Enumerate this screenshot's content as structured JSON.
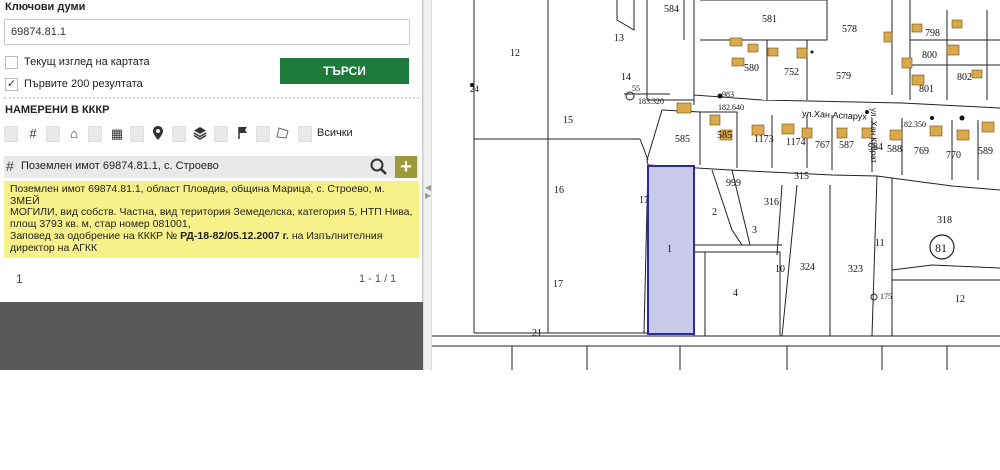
{
  "sidebar": {
    "keywords_label": "Ключови думи",
    "search_value": "69874.81.1",
    "option_current_view": "Текущ изглед на картата",
    "option_first_200": "Първите 200 резултата",
    "option_first_200_checked": true,
    "search_button": "ТЪРСИ",
    "found_in_label": "НАМЕРЕНИ В КККР",
    "filter_all_label": "Всички",
    "filter_icons": [
      "hash-icon",
      "home-icon",
      "building-icon",
      "location-pin-icon",
      "layers-icon",
      "flag-icon",
      "polygon-icon"
    ]
  },
  "result": {
    "title": "Поземлен имот 69874.81.1, с. Строево",
    "desc_line1": "Поземлен имот 69874.81.1, област Пловдив, община Марица, с. Строево, м. ЗМЕЙ",
    "desc_line2": "МОГИЛИ, вид собств. Частна, вид територия Земеделска, категория 5, НТП Нива,",
    "desc_line3": "площ 3793 кв. м, стар номер 081001,",
    "order_prefix": "Заповед за одобрение на КККР №",
    "order_number": "РД-18-82/05.12.2007 г.",
    "order_suffix": " на Изпълнителния",
    "order_line2": "директор на АГКК"
  },
  "pager": {
    "page": "1",
    "range": "1 - 1 / 1"
  },
  "map": {
    "street_1": "ул.Хан Аспарух",
    "street_2": "ул. Хан Кубрат",
    "elev_1": "183.320",
    "elev_2": "182.640",
    "elev_3": "182.350",
    "elev_4": "175",
    "circle_label": "81",
    "highlight_color": "#c9c9ea",
    "highlight_stroke": "#2a2aa8",
    "parcels": [
      "584",
      "581",
      "578",
      "798",
      "13",
      "12",
      "580",
      "752",
      "579",
      "800",
      "802",
      "14",
      "55",
      "983",
      "801",
      "24",
      "15",
      "585",
      "585",
      "1173",
      "1174",
      "767",
      "587",
      "984",
      "588",
      "769",
      "770",
      "589",
      "315",
      "999",
      "16",
      "316",
      "318",
      "17",
      "2",
      "3",
      "11",
      "1",
      "10",
      "324",
      "323",
      "4",
      "17",
      "12",
      "21"
    ]
  }
}
